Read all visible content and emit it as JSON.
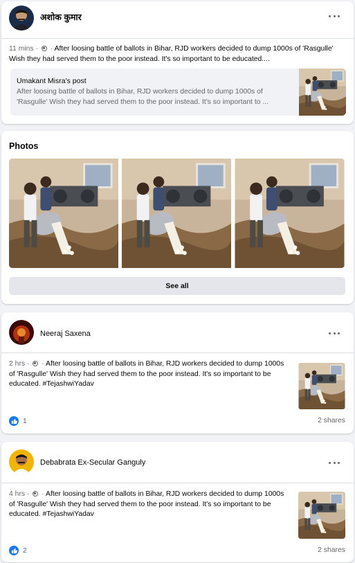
{
  "post1": {
    "author": "अशोक कुमार",
    "time": "11 mins",
    "dot": "·",
    "text": "After loosing battle of ballots in Bihar, RJD workers decided to dump 1000s of 'Rasgulle' Wish they had served them to the poor instead. It's so important to be educated....",
    "shared": {
      "title": "Umakant Misra's post",
      "text": "After loosing battle of ballots in Bihar, RJD workers decided to dump 1000s of 'Rasgulle' Wish they had served them to the poor instead. It's so important to ..."
    }
  },
  "photos": {
    "heading": "Photos",
    "see_all": "See all"
  },
  "post2": {
    "author": "Neeraj Saxena",
    "time": "2 hrs",
    "dot": "·",
    "text": "After loosing battle of ballots in Bihar, RJD workers decided to dump 1000s of 'Rasgulle' Wish they had served them to the poor instead. It's so important to be educated. #TejashwiYadav",
    "likes": "1",
    "shares": "2 shares"
  },
  "post3": {
    "author": "Debabrata Ex-Secular Ganguly",
    "time": "4 hrs",
    "dot": "·",
    "text": "After loosing battle of ballots in Bihar, RJD workers decided to dump 1000s of 'Rasgulle' Wish they had served them to the poor instead. It's so important to be educated. #TejashwiYadav",
    "likes": "2",
    "shares": "2 shares"
  },
  "icons": {
    "more": "more-options-icon",
    "globe": "globe-icon",
    "like": "like-icon"
  },
  "colors": {
    "like_blue": "#1877f2",
    "meta_gray": "#65676b",
    "feed_bg": "#f0f2f5"
  }
}
